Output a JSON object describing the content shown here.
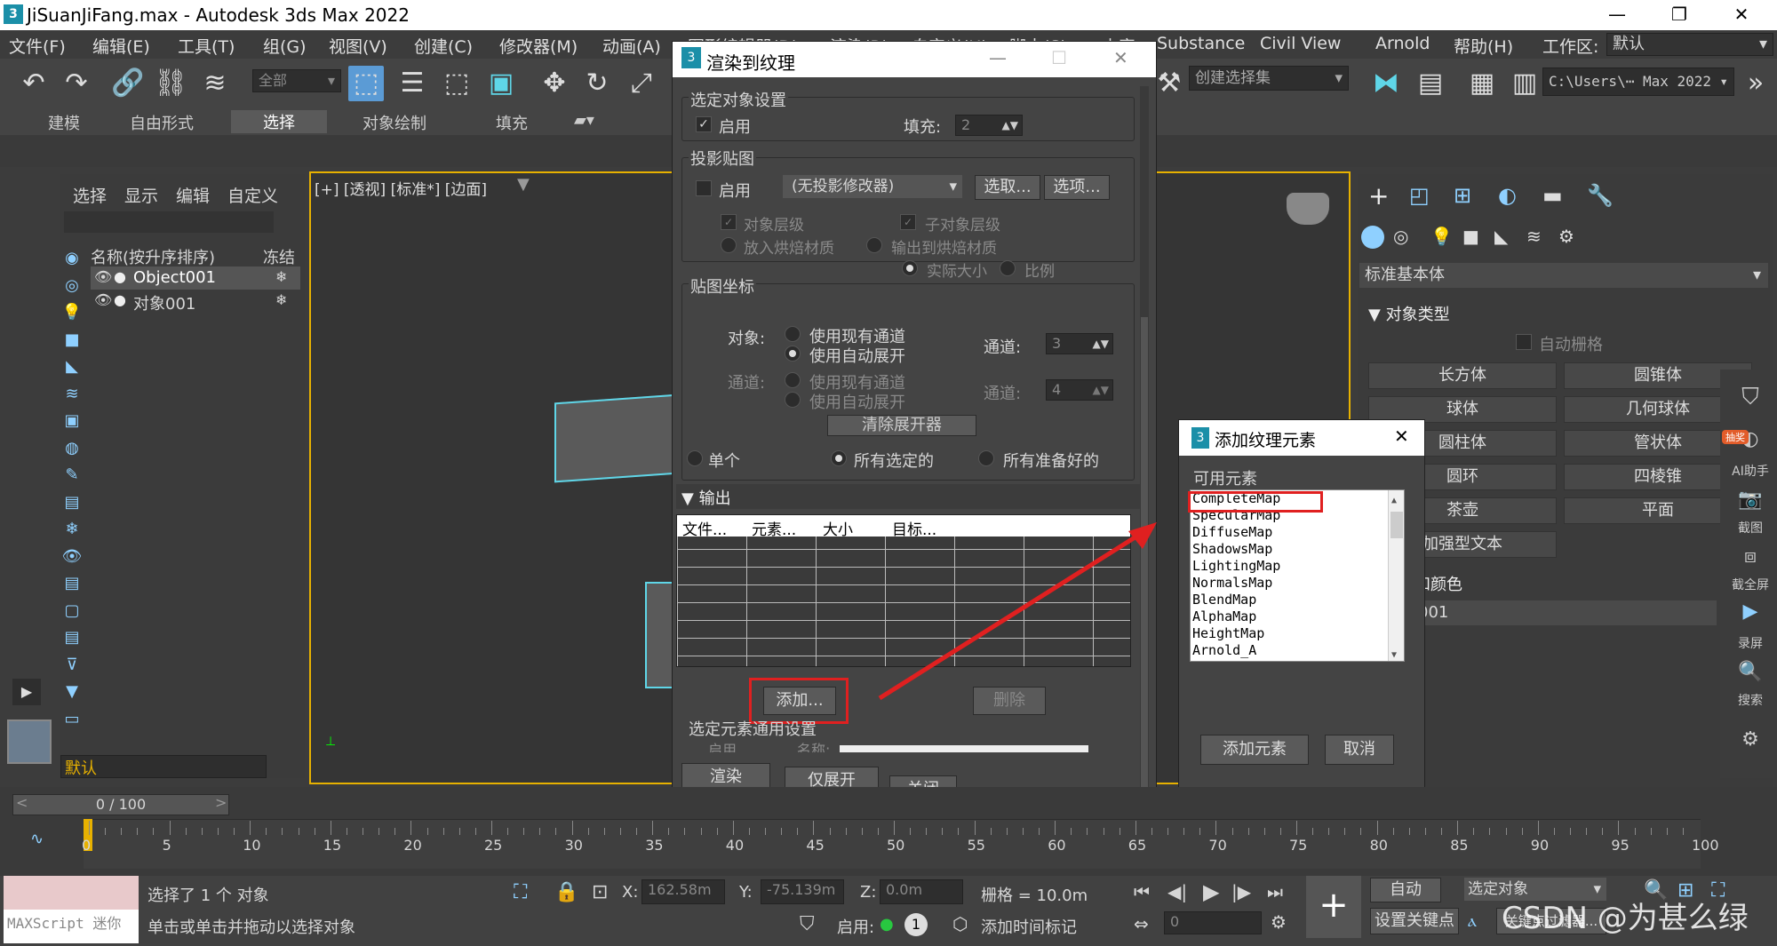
{
  "title_bar": {
    "logo": "3",
    "title": "JiSuanJiFang.max - Autodesk 3ds Max 2022",
    "minimize": "—",
    "restore": "❐",
    "close": "✕"
  },
  "menu": [
    "文件(F)",
    "编辑(E)",
    "工具(T)",
    "组(G)",
    "视图(V)",
    "创建(C)",
    "修改器(M)",
    "动画(A)",
    "图形编辑器(D)",
    "渲染(R)",
    "自定义(U)",
    "脚本(S)",
    "内容",
    "Substance",
    "Civil View",
    "Arnold",
    "帮助(H)"
  ],
  "workspace": {
    "label": "工作区:",
    "value": "默认"
  },
  "toolbar": {
    "filter_select": "全部",
    "selection_set": "创建选择集",
    "path": "C:\\Users\\⋯ Max 2022"
  },
  "ribbon_tabs": [
    "建模",
    "自由形式",
    "选择",
    "对象绘制",
    "填充"
  ],
  "scene_explorer": {
    "menus": [
      "选择",
      "显示",
      "编辑",
      "自定义"
    ],
    "col_name": "名称(按升序排序)",
    "col_freeze": "冻结",
    "rows": [
      {
        "name": "Object001",
        "selected": true
      },
      {
        "name": "对象001",
        "selected": false
      }
    ],
    "layer": "默认"
  },
  "viewport_label": "[+] [透视] [标准*] [边面]",
  "render_to_texture": {
    "title": "渲染到纹理",
    "sec_object": "选定对象设置",
    "enable": "启用",
    "padding_label": "填充:",
    "padding_value": "2",
    "sec_projection": "投影贴图",
    "proj_enable": "启用",
    "proj_modifier": "(无投影修改器)",
    "pick_btn": "选取...",
    "options_btn": "选项...",
    "object_level": "对象层级",
    "sub_object_level": "子对象层级",
    "put_bake_mat": "放入烘焙材质",
    "output_bake_mat": "输出到烘焙材质",
    "actual_size": "实际大小",
    "proportion": "比例",
    "sec_mapping": "贴图坐标",
    "object_label": "对象:",
    "use_existing": "使用现有通道",
    "use_auto_unwrap": "使用自动展开",
    "channel_label": "通道:",
    "channel_value": "3",
    "channel_label2": "通道:",
    "channel_value2": "4",
    "clear_unwrap": "清除展开器",
    "single": "单个",
    "all_selected": "所有选定的",
    "all_prepared": "所有准备好的",
    "sec_output": "输出",
    "output_columns": [
      "文件...",
      "元素...",
      "大小",
      "目标..."
    ],
    "add_btn": "添加...",
    "delete_btn": "删除",
    "sec_element_common": "选定元素通用设置",
    "enable2": "启用",
    "name_label": "名称:",
    "render_btn": "渲染",
    "unwrap_only_btn": "仅展开",
    "close_btn": "关闭"
  },
  "add_element": {
    "title": "添加纹理元素",
    "available": "可用元素",
    "items": [
      "CompleteMap",
      "SpecularMap",
      "DiffuseMap",
      "ShadowsMap",
      "LightingMap",
      "NormalsMap",
      "BlendMap",
      "AlphaMap",
      "HeightMap",
      "Arnold_A"
    ],
    "add_btn": "添加元素",
    "cancel_btn": "取消"
  },
  "command_panel": {
    "category": "标准基本体",
    "object_type": "对象类型",
    "autogrid": "自动栅格",
    "buttons": [
      "长方体",
      "圆锥体",
      "球体",
      "几何球体",
      "圆柱体",
      "管状体",
      "圆环",
      "四棱锥",
      "茶壶",
      "平面"
    ],
    "text_plus": "加强型文本",
    "name_color": "和颜色",
    "obj_name": "001"
  },
  "side_tools": [
    {
      "icon": "shield-icon",
      "label": ""
    },
    {
      "icon": "ai-icon",
      "label": "AI助手",
      "badge": "抽奖"
    },
    {
      "icon": "camera-icon",
      "label": "截图"
    },
    {
      "icon": "screenshot-icon",
      "label": "截全屏"
    },
    {
      "icon": "record-icon",
      "label": "录屏"
    },
    {
      "icon": "search-icon",
      "label": "搜索"
    }
  ],
  "timeline": {
    "frame_display": "0 / 100",
    "ticks": [
      "0",
      "5",
      "10",
      "15",
      "20",
      "25",
      "30",
      "35",
      "40",
      "45",
      "50",
      "55",
      "60",
      "65",
      "70",
      "75",
      "80",
      "85",
      "90",
      "95",
      "100"
    ]
  },
  "status": {
    "maxscript": "MAXScript 迷你",
    "selected": "选择了 1 个 对象",
    "hint": "单击或单击并拖动以选择对象",
    "x_label": "X:",
    "x_value": "162.58m",
    "y_label": "Y:",
    "y_value": "-75.139m",
    "z_label": "Z:",
    "z_value": "0.0m",
    "grid": "栅格 = 10.0m",
    "enable": "启用:",
    "add_time_tag": "添加时间标记",
    "auto": "自动",
    "selected_object": "选定对象",
    "set_key": "设置关键点",
    "key_filter": "关键点过滤器...",
    "frame": "0",
    "watermark": "CSDN @为甚么绿"
  }
}
